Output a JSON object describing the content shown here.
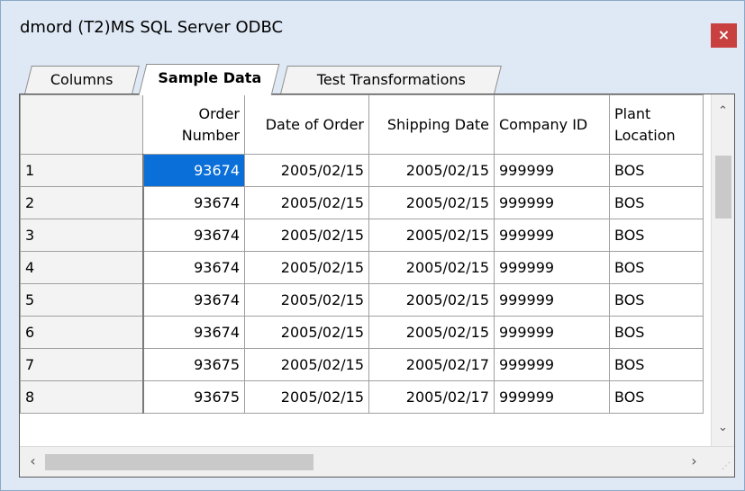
{
  "window": {
    "title": "dmord (T2)MS SQL Server ODBC",
    "close_label": "×"
  },
  "tabs": [
    {
      "label": "Columns",
      "active": false
    },
    {
      "label": "Sample Data",
      "active": true
    },
    {
      "label": "Test Transformations",
      "active": false
    }
  ],
  "grid": {
    "headers": {
      "order_number": "Order Number",
      "date_of_order": "Date of Order",
      "shipping_date": "Shipping Date",
      "company_id": "Company ID",
      "plant_location": "Plant Location"
    },
    "rows": [
      {
        "index": "1",
        "order_number": "93674",
        "date_of_order": "2005/02/15",
        "shipping_date": "2005/02/15",
        "company_id": "999999",
        "plant_location": "BOS"
      },
      {
        "index": "2",
        "order_number": "93674",
        "date_of_order": "2005/02/15",
        "shipping_date": "2005/02/15",
        "company_id": "999999",
        "plant_location": "BOS"
      },
      {
        "index": "3",
        "order_number": "93674",
        "date_of_order": "2005/02/15",
        "shipping_date": "2005/02/15",
        "company_id": "999999",
        "plant_location": "BOS"
      },
      {
        "index": "4",
        "order_number": "93674",
        "date_of_order": "2005/02/15",
        "shipping_date": "2005/02/15",
        "company_id": "999999",
        "plant_location": "BOS"
      },
      {
        "index": "5",
        "order_number": "93674",
        "date_of_order": "2005/02/15",
        "shipping_date": "2005/02/15",
        "company_id": "999999",
        "plant_location": "BOS"
      },
      {
        "index": "6",
        "order_number": "93674",
        "date_of_order": "2005/02/15",
        "shipping_date": "2005/02/15",
        "company_id": "999999",
        "plant_location": "BOS"
      },
      {
        "index": "7",
        "order_number": "93675",
        "date_of_order": "2005/02/15",
        "shipping_date": "2005/02/17",
        "company_id": "999999",
        "plant_location": "BOS"
      },
      {
        "index": "8",
        "order_number": "93675",
        "date_of_order": "2005/02/15",
        "shipping_date": "2005/02/17",
        "company_id": "999999",
        "plant_location": "BOS"
      }
    ],
    "selected_cell": {
      "row": 0,
      "column": "order_number"
    }
  },
  "scrollbars": {
    "up_icon": "chevron-up-icon",
    "down_icon": "chevron-down-icon",
    "left_icon": "chevron-left-icon",
    "right_icon": "chevron-right-icon"
  },
  "colors": {
    "selection": "#0a6fd8",
    "close_button": "#c94040",
    "title_bar": "#dfe9f5"
  }
}
